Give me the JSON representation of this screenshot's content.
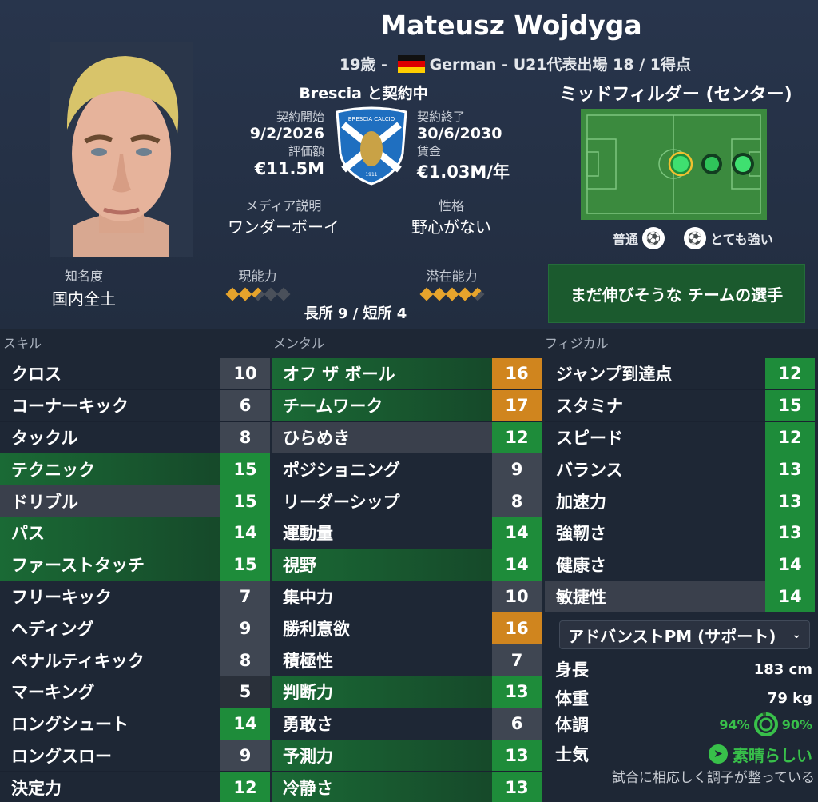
{
  "player": {
    "name": "Mateusz Wojdyga",
    "age": "19歳",
    "nation": "German",
    "intl": "U21代表出場 18 / 1得点",
    "club_contract": "Brescia と契約中",
    "contract_start_label": "契約開始",
    "contract_start": "9/2/2026",
    "contract_end_label": "契約終了",
    "contract_end": "30/6/2030",
    "value_label": "評価額",
    "value": "€11.5M",
    "wage_label": "賃金",
    "wage": "€1.03M/年",
    "media_label": "メディア説明",
    "media": "ワンダーボーイ",
    "personality_label": "性格",
    "personality": "野心がない",
    "crest_text": "BRESCIA CALCIO",
    "crest_year": "1911"
  },
  "position": {
    "title": "ミッドフィルダー (センター)",
    "normal": "普通",
    "strong": "とても強い"
  },
  "reputation": {
    "label": "知名度",
    "value": "国内全土"
  },
  "ability": {
    "current_label": "現能力",
    "current_stars": 2.5,
    "potential_label": "潜在能力",
    "potential_stars": 4.5,
    "strengths": "長所 9 / 短所 4"
  },
  "button_label": "まだ伸びそうな チームの選手",
  "sections": {
    "skill": "スキル",
    "mental": "メンタル",
    "physical": "フィジカル"
  },
  "skills": [
    {
      "name": "クロス",
      "value": "10"
    },
    {
      "name": "コーナーキック",
      "value": "6"
    },
    {
      "name": "タックル",
      "value": "8"
    },
    {
      "name": "テクニック",
      "value": "15"
    },
    {
      "name": "ドリブル",
      "value": "15"
    },
    {
      "name": "パス",
      "value": "14"
    },
    {
      "name": "ファーストタッチ",
      "value": "15"
    },
    {
      "name": "フリーキック",
      "value": "7"
    },
    {
      "name": "ヘディング",
      "value": "9"
    },
    {
      "name": "ペナルティキック",
      "value": "8"
    },
    {
      "name": "マーキング",
      "value": "5"
    },
    {
      "name": "ロングシュート",
      "value": "14"
    },
    {
      "name": "ロングスロー",
      "value": "9"
    },
    {
      "name": "決定力",
      "value": "12"
    }
  ],
  "mental": [
    {
      "name": "オフ ザ ボール",
      "value": "16"
    },
    {
      "name": "チームワーク",
      "value": "17"
    },
    {
      "name": "ひらめき",
      "value": "12"
    },
    {
      "name": "ポジショニング",
      "value": "9"
    },
    {
      "name": "リーダーシップ",
      "value": "8"
    },
    {
      "name": "運動量",
      "value": "14"
    },
    {
      "name": "視野",
      "value": "14"
    },
    {
      "name": "集中力",
      "value": "10"
    },
    {
      "name": "勝利意欲",
      "value": "16"
    },
    {
      "name": "積極性",
      "value": "7"
    },
    {
      "name": "判断力",
      "value": "13"
    },
    {
      "name": "勇敢さ",
      "value": "6"
    },
    {
      "name": "予測力",
      "value": "13"
    },
    {
      "name": "冷静さ",
      "value": "13"
    }
  ],
  "physical": [
    {
      "name": "ジャンプ到達点",
      "value": "12"
    },
    {
      "name": "スタミナ",
      "value": "15"
    },
    {
      "name": "スピード",
      "value": "12"
    },
    {
      "name": "バランス",
      "value": "13"
    },
    {
      "name": "加速力",
      "value": "13"
    },
    {
      "name": "強靭さ",
      "value": "13"
    },
    {
      "name": "健康さ",
      "value": "14"
    },
    {
      "name": "敏捷性",
      "value": "14"
    }
  ],
  "role": "アドバンストPM (サポート)",
  "info": {
    "height_label": "身長",
    "height": "183 cm",
    "weight_label": "体重",
    "weight": "79 kg",
    "condition_label": "体調",
    "condition": "94%",
    "sharpness": "90%",
    "morale_label": "士気",
    "morale": "素晴らしい",
    "note": "試合に相応しく調子が整っている"
  },
  "colors": {
    "green": "#1e8c3a",
    "orange": "#d0851e",
    "highlight": "#1a6a35",
    "gold": "#e7a42c"
  }
}
